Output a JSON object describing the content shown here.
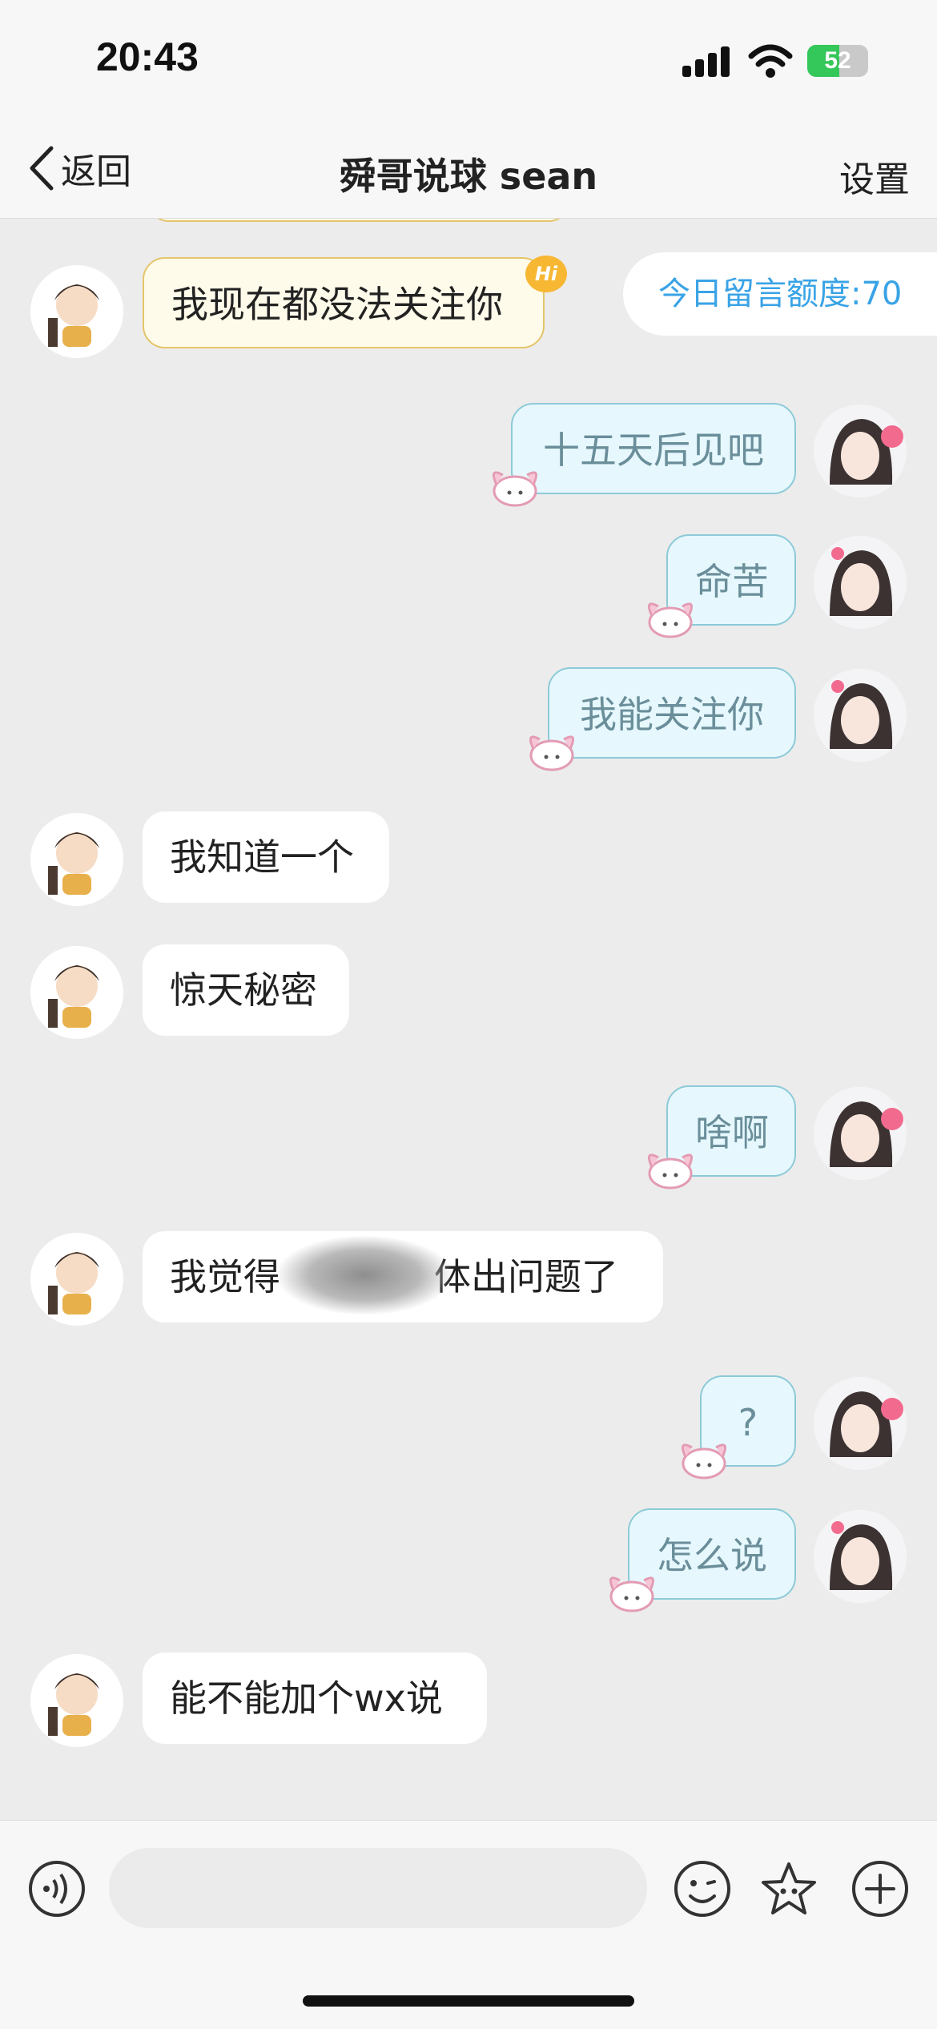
{
  "status_bar": {
    "time": "20:43",
    "battery": "52",
    "battery_level": 0.52
  },
  "nav": {
    "back_label": "返回",
    "title": "舜哥说球 sean",
    "settings_label": "设置"
  },
  "quota": {
    "text": "今日留言额度:70"
  },
  "hi_badge": "Hi",
  "messages": [
    {
      "side": "in",
      "text": "我现在都没法关注你"
    },
    {
      "side": "out",
      "text": "十五天后见吧"
    },
    {
      "side": "out",
      "text": "命苦"
    },
    {
      "side": "out",
      "text": "我能关注你"
    },
    {
      "side": "in",
      "text": "我知道一个"
    },
    {
      "side": "in",
      "text": "惊天秘密"
    },
    {
      "side": "out",
      "text": "啥啊"
    },
    {
      "side": "in",
      "text_before": "我觉得",
      "text_after": "体出问题了"
    },
    {
      "side": "out",
      "text": "?"
    },
    {
      "side": "out",
      "text": "怎么说"
    },
    {
      "side": "in",
      "text": "能不能加个wx说"
    }
  ],
  "input": {
    "value": "",
    "placeholder": ""
  },
  "colors": {
    "accent_blue": "#3aa3e6",
    "out_bubble": "#e6f8fd",
    "out_border": "#8dcad8",
    "gold_border": "#e4c56a"
  },
  "icons": [
    "back-chevron-icon",
    "signal-icon",
    "wifi-icon",
    "battery-icon",
    "voice-icon",
    "emoji-icon",
    "star-icon",
    "plus-icon"
  ]
}
